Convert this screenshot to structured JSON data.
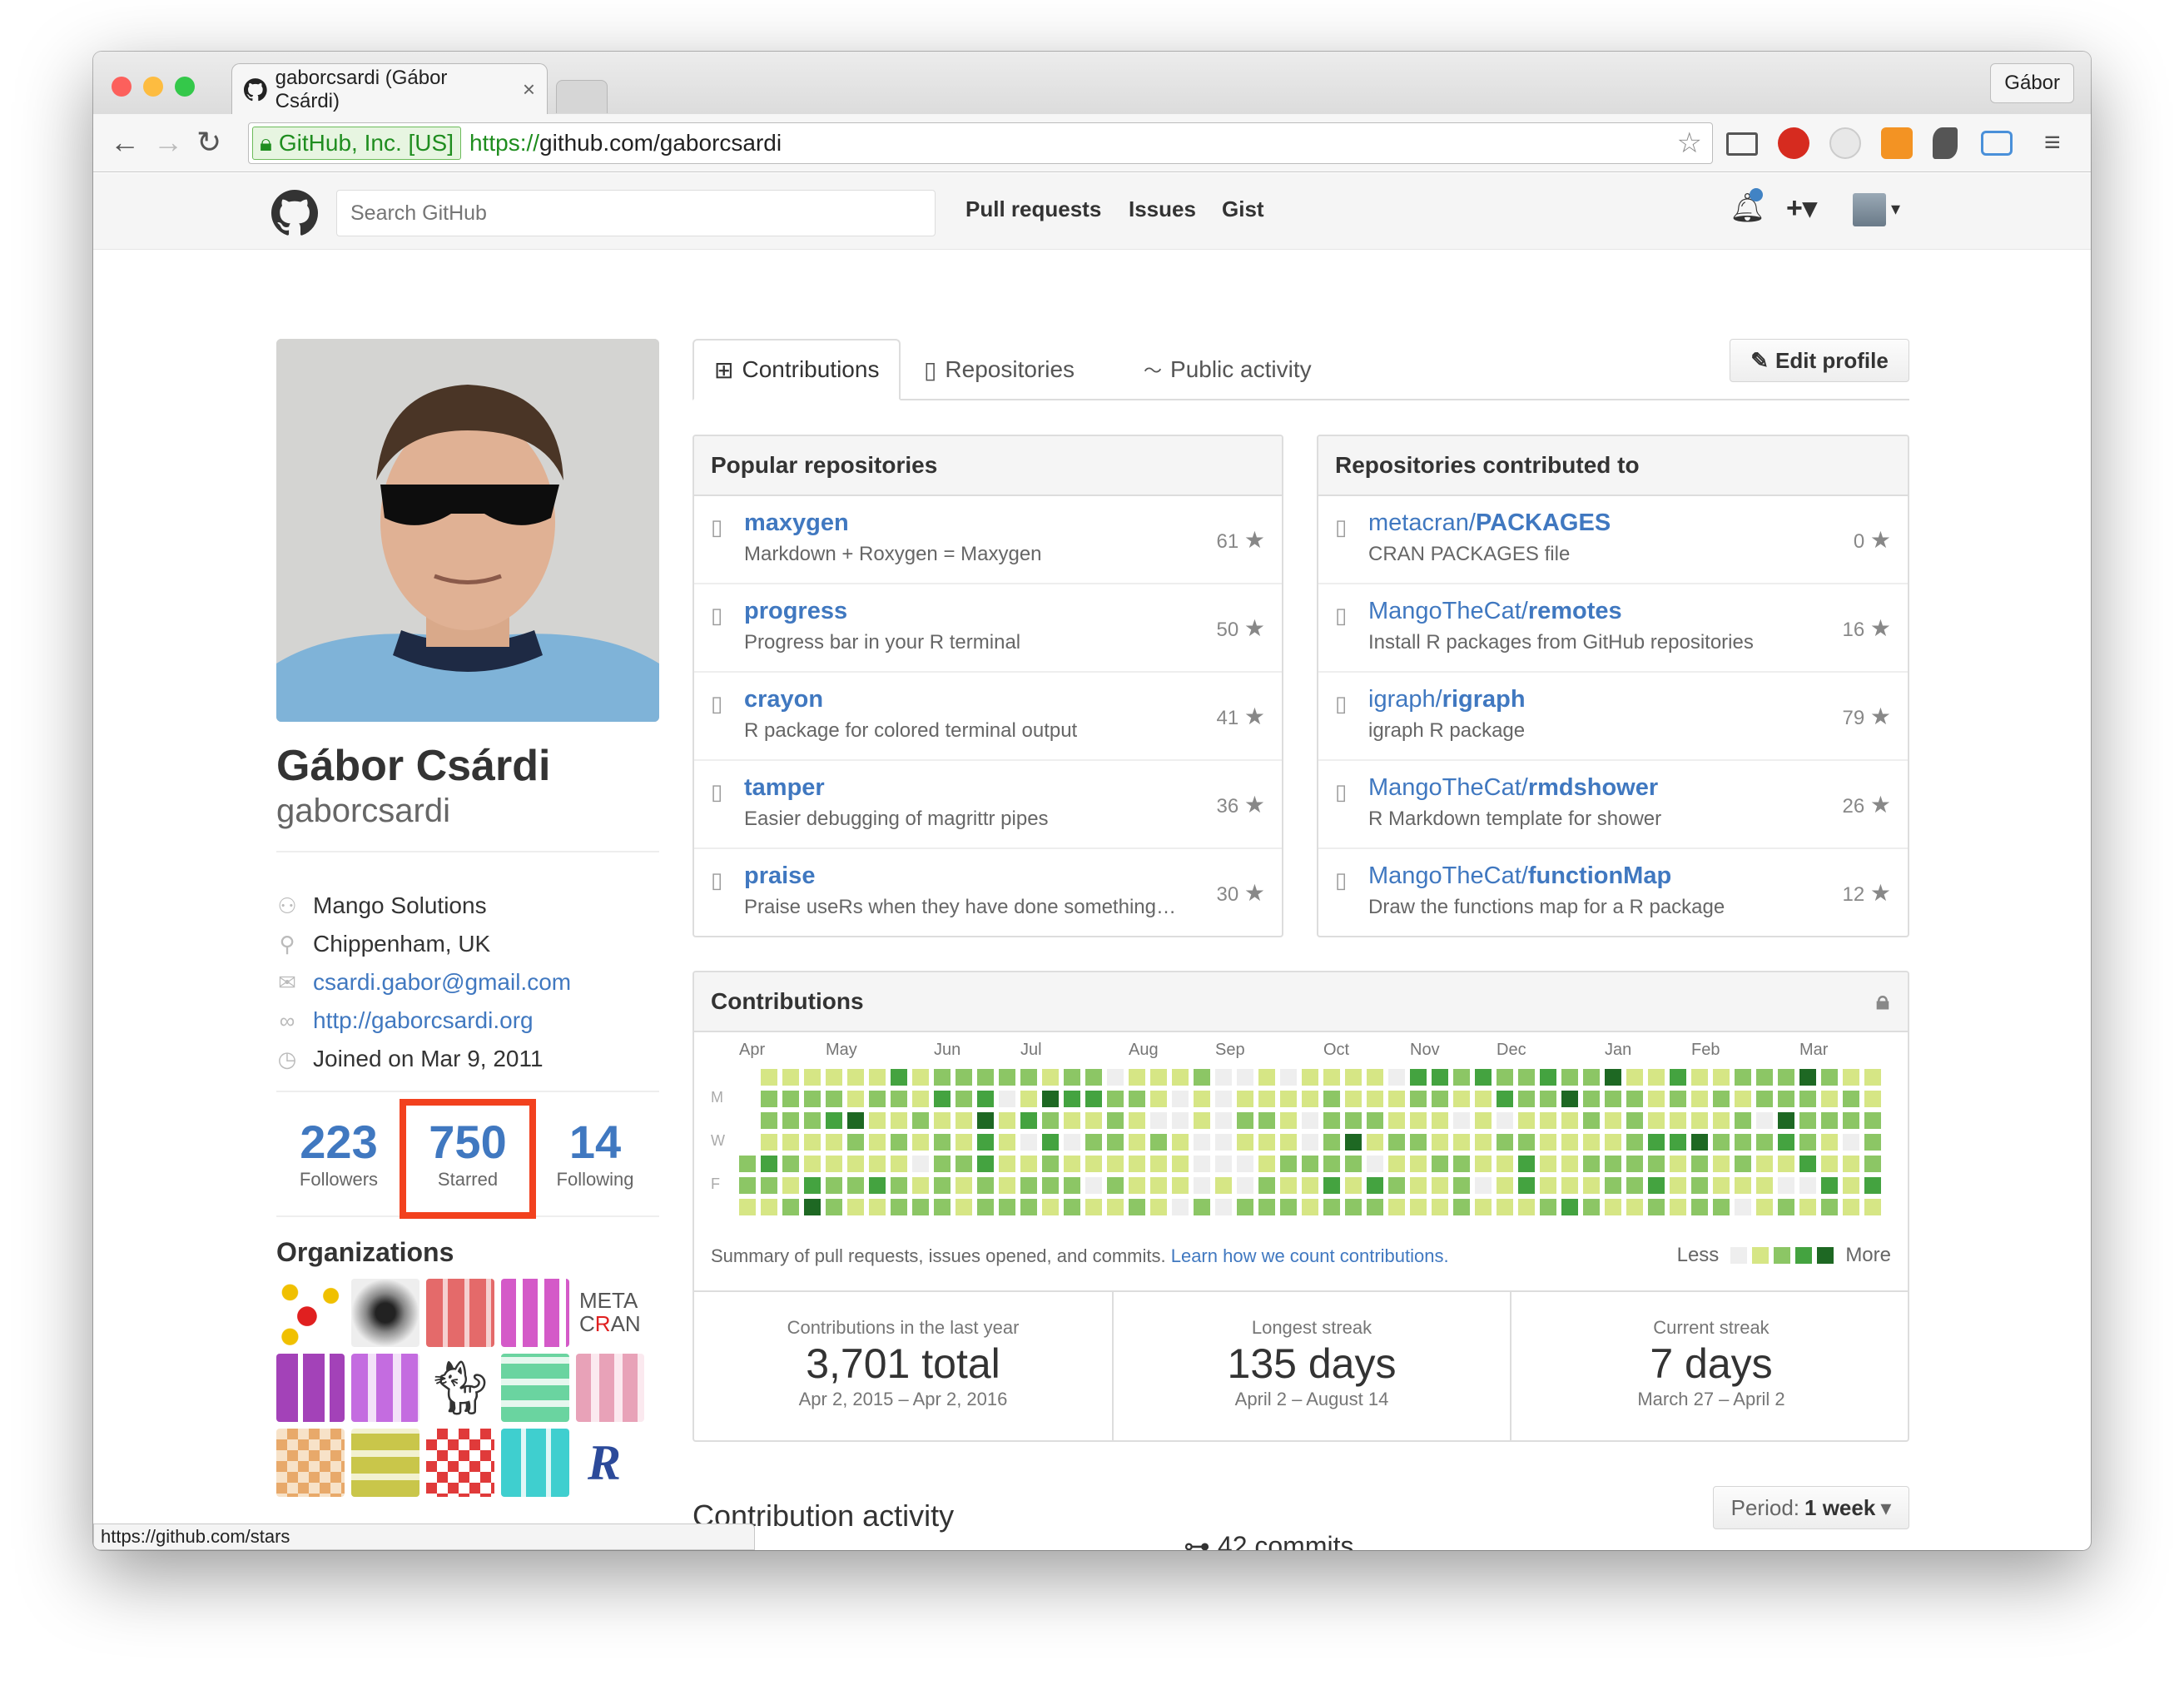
{
  "browser": {
    "tab_title": "gaborcsardi (Gábor Csárdi)",
    "tab_close": "×",
    "profile_name": "Gábor",
    "ev_label": "GitHub, Inc. [US]",
    "url_scheme": "https://",
    "url_rest": "github.com/gaborcsardi",
    "status_url": "https://github.com/stars"
  },
  "header": {
    "search_placeholder": "Search GitHub",
    "nav": [
      "Pull requests",
      "Issues",
      "Gist"
    ],
    "plus": "+▾"
  },
  "profile": {
    "fullname": "Gábor Csárdi",
    "username": "gaborcsardi",
    "company": "Mango Solutions",
    "location": "Chippenham, UK",
    "email": "csardi.gabor@gmail.com",
    "website": "http://gaborcsardi.org",
    "joined": "Joined on Mar 9, 2011",
    "followers_count": "223",
    "followers_label": "Followers",
    "starred_count": "750",
    "starred_label": "Starred",
    "following_count": "14",
    "following_label": "Following",
    "orgs_title": "Organizations"
  },
  "tabs": {
    "contributions": "Contributions",
    "repositories": "Repositories",
    "public_activity": "Public activity",
    "edit_profile": "Edit profile"
  },
  "popular": {
    "title": "Popular repositories",
    "repos": [
      {
        "owner": "",
        "name": "maxygen",
        "desc": "Markdown + Roxygen = Maxygen",
        "stars": "61"
      },
      {
        "owner": "",
        "name": "progress",
        "desc": "Progress bar in your R terminal",
        "stars": "50"
      },
      {
        "owner": "",
        "name": "crayon",
        "desc": "R package for colored terminal output",
        "stars": "41"
      },
      {
        "owner": "",
        "name": "tamper",
        "desc": "Easier debugging of magrittr pipes",
        "stars": "36"
      },
      {
        "owner": "",
        "name": "praise",
        "desc": "Praise useRs when they have done something…",
        "stars": "30"
      }
    ]
  },
  "contributed": {
    "title": "Repositories contributed to",
    "repos": [
      {
        "owner": "metacran/",
        "name": "PACKAGES",
        "desc": "CRAN PACKAGES file",
        "stars": "0"
      },
      {
        "owner": "MangoTheCat/",
        "name": "remotes",
        "desc": "Install R packages from GitHub repositories",
        "stars": "16"
      },
      {
        "owner": "igraph/",
        "name": "rigraph",
        "desc": "igraph R package",
        "stars": "79"
      },
      {
        "owner": "MangoTheCat/",
        "name": "rmdshower",
        "desc": "R Markdown template for shower",
        "stars": "26"
      },
      {
        "owner": "MangoTheCat/",
        "name": "functionMap",
        "desc": "Draw the functions map for a R package",
        "stars": "12"
      }
    ]
  },
  "contrib": {
    "title": "Contributions",
    "months": [
      "Apr",
      "May",
      "Jun",
      "Jul",
      "Aug",
      "Sep",
      "Oct",
      "Nov",
      "Dec",
      "Jan",
      "Feb",
      "Mar"
    ],
    "days": [
      "M",
      "W",
      "F"
    ],
    "summary": "Summary of pull requests, issues opened, and commits.",
    "learn_link": "Learn how we count contributions.",
    "less": "Less",
    "more": "More",
    "colors": [
      "#eeeeee",
      "#d6e685",
      "#8cc665",
      "#44a340",
      "#1e6823"
    ],
    "stats": [
      {
        "title": "Contributions in the last year",
        "value": "3,701 total",
        "range": "Apr 2, 2015 – Apr 2, 2016"
      },
      {
        "title": "Longest streak",
        "value": "135 days",
        "range": "April 2 – August 14"
      },
      {
        "title": "Current streak",
        "value": "7 days",
        "range": "March 27 – April 2"
      }
    ]
  },
  "activity": {
    "title": "Contribution activity",
    "period_label": "Period:",
    "period_value": "1 week",
    "commits": "42 commits"
  }
}
